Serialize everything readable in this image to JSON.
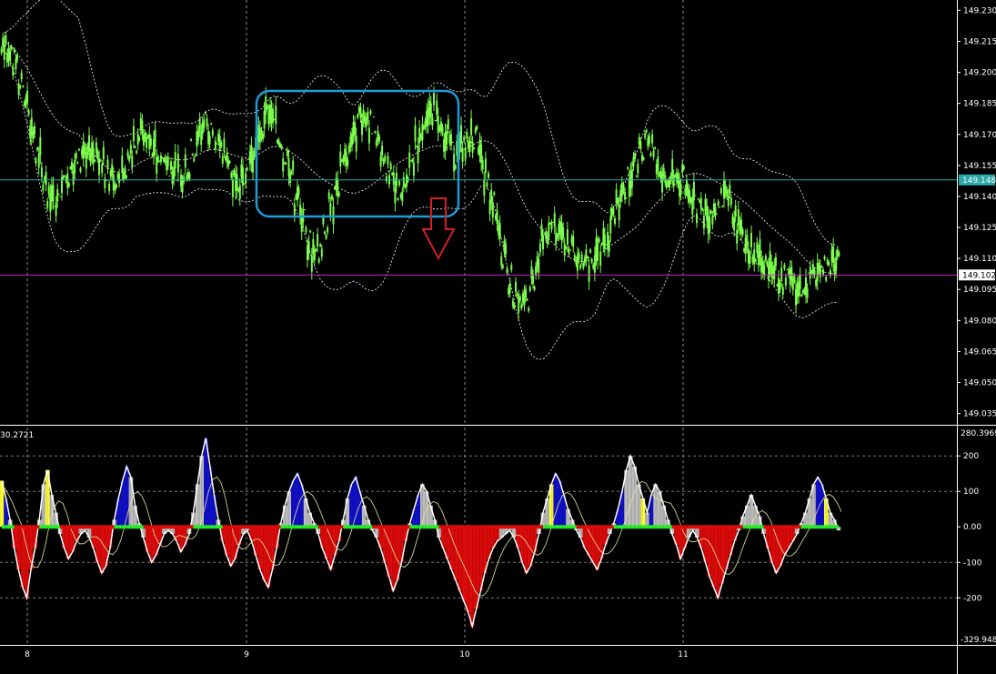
{
  "chart_data": [
    {
      "type": "candlestick",
      "title": "",
      "price_labels": [
        "149.230",
        "149.215",
        "149.200",
        "149.185",
        "149.170",
        "149.155",
        "149.140",
        "149.125",
        "149.110",
        "149.095",
        "149.080",
        "149.065",
        "149.050",
        "149.035"
      ],
      "ylim": [
        149.03,
        149.235
      ],
      "y_ticks": [
        149.23,
        149.215,
        149.2,
        149.185,
        149.17,
        149.155,
        149.14,
        149.125,
        149.11,
        149.095,
        149.08,
        149.065,
        149.05,
        149.035
      ],
      "date_labels": [
        "8",
        "9",
        "10",
        "11"
      ],
      "current_price": {
        "label": "149.148",
        "value": 149.148,
        "color": "#2aa7a7"
      },
      "level_line": {
        "label": "149.102",
        "value": 149.102,
        "color": "#c02bb8"
      },
      "candle_color": "#7CFC4C",
      "band_color": "#ffffff",
      "highlight_box": {
        "color": "#1e9ad6"
      },
      "arrow": {
        "direction": "down",
        "color": "#d42020"
      },
      "closes": [
        149.215,
        149.212,
        149.205,
        149.195,
        149.185,
        149.172,
        149.16,
        149.15,
        149.142,
        149.138,
        149.145,
        149.15,
        149.155,
        149.158,
        149.162,
        149.16,
        149.158,
        149.155,
        149.15,
        149.148,
        149.15,
        149.155,
        149.16,
        149.165,
        149.17,
        149.168,
        149.165,
        149.16,
        149.158,
        149.155,
        149.152,
        149.15,
        149.155,
        149.162,
        149.17,
        149.176,
        149.172,
        149.165,
        149.16,
        149.155,
        149.15,
        149.148,
        149.152,
        149.158,
        149.165,
        149.172,
        149.18,
        149.176,
        149.168,
        149.16,
        149.15,
        149.138,
        149.128,
        149.118,
        149.112,
        149.115,
        149.125,
        149.135,
        149.145,
        149.155,
        149.162,
        149.17,
        149.178,
        149.18,
        149.175,
        149.168,
        149.16,
        149.152,
        149.146,
        149.142,
        149.148,
        149.156,
        149.165,
        149.172,
        149.178,
        149.182,
        149.178,
        149.17,
        149.162,
        149.16,
        149.165,
        149.17,
        149.168,
        149.16,
        149.15,
        149.138,
        149.125,
        149.112,
        149.1,
        149.092,
        149.085,
        149.09,
        149.1,
        149.11,
        149.118,
        149.122,
        149.125,
        149.122,
        149.118,
        149.115,
        149.112,
        149.11,
        149.108,
        149.11,
        149.115,
        149.122,
        149.13,
        149.138,
        149.145,
        149.15,
        149.155,
        149.162,
        149.168,
        149.162,
        149.155,
        149.15,
        149.148,
        149.15,
        149.148,
        149.145,
        149.14,
        149.135,
        149.132,
        149.132,
        149.135,
        149.14,
        149.138,
        149.132,
        149.125,
        149.12,
        149.115,
        149.112,
        149.11,
        149.108,
        149.105,
        149.102,
        149.1,
        149.098,
        149.096,
        149.095,
        149.098,
        149.1,
        149.102,
        149.105,
        149.108,
        149.11
      ],
      "indicator": {
        "type": "histogram",
        "max_label": "280.3969",
        "min_label": "-329.9487",
        "left_label": "30.2721",
        "levels": [
          "200",
          "100",
          "0.00",
          "-100",
          "-200"
        ],
        "level_values": [
          200,
          100,
          0,
          -100,
          -200
        ],
        "ylim": [
          -330,
          280
        ],
        "colors": {
          "positive": "#1010c8",
          "negative": "#dd0a0a",
          "neutral": "#bdbdbd",
          "signal": "#ffff33",
          "zero_line": "#22ee22",
          "line": "#ffffff"
        },
        "values": [
          130,
          80,
          20,
          -60,
          -120,
          -170,
          -200,
          -120,
          -60,
          20,
          120,
          160,
          90,
          40,
          -20,
          -60,
          -90,
          -70,
          -40,
          -20,
          -10,
          -30,
          -60,
          -100,
          -130,
          -110,
          -60,
          20,
          80,
          130,
          170,
          140,
          60,
          10,
          -30,
          -70,
          -100,
          -80,
          -50,
          -20,
          -10,
          -20,
          -40,
          -70,
          -50,
          -20,
          40,
          120,
          200,
          250,
          170,
          90,
          20,
          -40,
          -80,
          -110,
          -90,
          -50,
          -20,
          -10,
          -40,
          -80,
          -120,
          -150,
          -170,
          -120,
          -60,
          10,
          60,
          100,
          130,
          150,
          120,
          80,
          40,
          10,
          -20,
          -60,
          -90,
          -120,
          -80,
          -40,
          20,
          80,
          120,
          140,
          100,
          60,
          20,
          -10,
          -30,
          -60,
          -100,
          -140,
          -180,
          -150,
          -100,
          -40,
          10,
          50,
          90,
          120,
          100,
          60,
          20,
          -30,
          -60,
          -90,
          -120,
          -150,
          -180,
          -210,
          -240,
          -280,
          -230,
          -180,
          -130,
          -90,
          -60,
          -40,
          -30,
          -20,
          -10,
          -30,
          -60,
          -100,
          -130,
          -110,
          -70,
          -20,
          40,
          80,
          120,
          150,
          130,
          90,
          50,
          20,
          -10,
          -30,
          -60,
          -80,
          -100,
          -120,
          -90,
          -50,
          -20,
          10,
          50,
          100,
          160,
          200,
          170,
          120,
          80,
          40,
          90,
          120,
          100,
          60,
          20,
          -20,
          -50,
          -90,
          -60,
          -30,
          -10,
          -30,
          -60,
          -100,
          -140,
          -170,
          -200,
          -160,
          -120,
          -80,
          -40,
          -10,
          30,
          60,
          90,
          60,
          30,
          -20,
          -60,
          -100,
          -130,
          -110,
          -80,
          -60,
          -40,
          -20,
          10,
          40,
          80,
          120,
          140,
          120,
          80,
          40,
          20,
          -10
        ]
      }
    }
  ]
}
